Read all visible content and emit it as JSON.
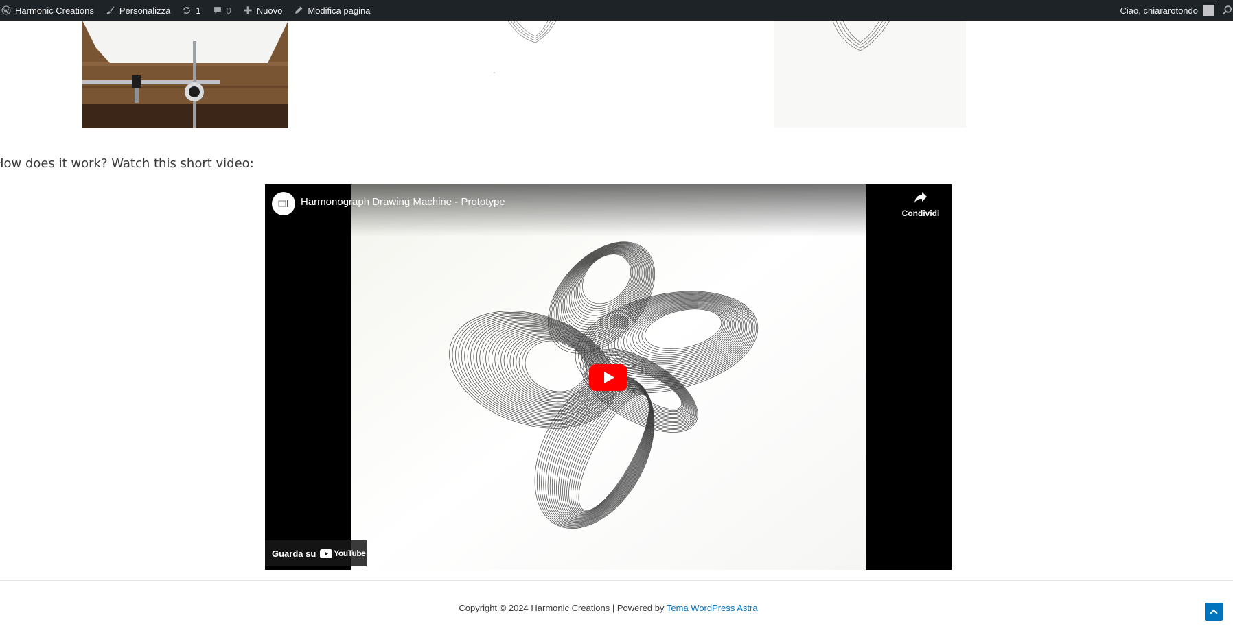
{
  "admin_bar": {
    "site_name": "Harmonic Creations",
    "customize": "Personalizza",
    "updates_count": "1",
    "comments_count": "0",
    "new": "Nuovo",
    "edit_page": "Modifica pagina",
    "greeting": "Ciao, chiararotondo"
  },
  "content": {
    "question": "How does it work? Watch this short video:"
  },
  "video": {
    "title": "Harmonograph Drawing Machine - Prototype",
    "share_label": "Condividi",
    "watch_on": "Guarda su",
    "youtube": "YouTube"
  },
  "footer": {
    "copyright": "Copyright © 2024 Harmonic Creations | Powered by ",
    "theme_link": "Tema WordPress Astra"
  },
  "colors": {
    "admin_bar_bg": "#1d2327",
    "link": "#0274be",
    "youtube_red": "#ff0000"
  },
  "icons": {
    "site": "wordpress-icon",
    "customize": "brush-icon",
    "updates": "refresh-icon",
    "comments": "comment-icon",
    "new": "plus-icon",
    "edit": "pencil-icon",
    "search": "search-icon",
    "share": "share-icon",
    "play": "play-icon",
    "scroll_top": "chevron-up-icon"
  }
}
